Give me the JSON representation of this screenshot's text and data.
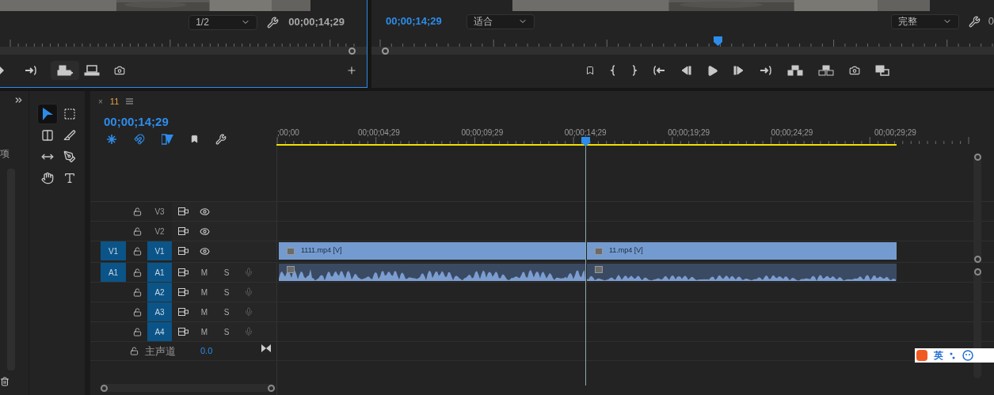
{
  "source_monitor": {
    "zoom": "1/2",
    "timecode": "00;00;14;29"
  },
  "program_monitor": {
    "timecode": "00;00;14;29",
    "fit": "适合",
    "quality": "完整",
    "timecode_cut": "0"
  },
  "project_panel": {
    "count": "项"
  },
  "tools": [
    {
      "kind": "selection",
      "selected": true
    },
    {
      "kind": "track-select",
      "selected": false
    },
    {
      "kind": "ripple",
      "selected": false
    },
    {
      "kind": "razor",
      "selected": false
    },
    {
      "kind": "slip",
      "selected": false
    },
    {
      "kind": "pen",
      "selected": false
    },
    {
      "kind": "hand",
      "selected": false
    },
    {
      "kind": "type",
      "selected": false
    }
  ],
  "timeline": {
    "close": "×",
    "tab": "11",
    "timecode": "00;00;14;29",
    "ruler_labels": [
      ";00;00",
      "00;00;04;29",
      "00;00;09;29",
      "00;00;14;29",
      "00;00;19;29",
      "00;00;24;29",
      "00;00;29;29"
    ],
    "tracks": [
      {
        "kind": "video",
        "target": "V3",
        "targeted": false
      },
      {
        "kind": "video",
        "target": "V2",
        "targeted": false
      },
      {
        "kind": "video",
        "source_patch": "V1",
        "target": "V1",
        "targeted": true,
        "clips": [
          {
            "name": "1111.mp4 [V]"
          },
          {
            "name": "11.mp4 [V]"
          }
        ]
      },
      {
        "kind": "audio",
        "source_patch": "A1",
        "target": "A1",
        "targeted": true,
        "mute": "M",
        "solo": "S",
        "clips": [
          {
            "kind": "audio"
          },
          {
            "kind": "audio"
          }
        ]
      },
      {
        "kind": "audio",
        "target": "A2",
        "targeted": true,
        "mute": "M",
        "solo": "S"
      },
      {
        "kind": "audio",
        "target": "A3",
        "targeted": true,
        "mute": "M",
        "solo": "S"
      },
      {
        "kind": "audio",
        "target": "A4",
        "targeted": true,
        "mute": "M",
        "solo": "S"
      },
      {
        "kind": "master",
        "label": "主声道",
        "value": "0.0"
      }
    ]
  },
  "ime_bar": {
    "mode": "英"
  }
}
